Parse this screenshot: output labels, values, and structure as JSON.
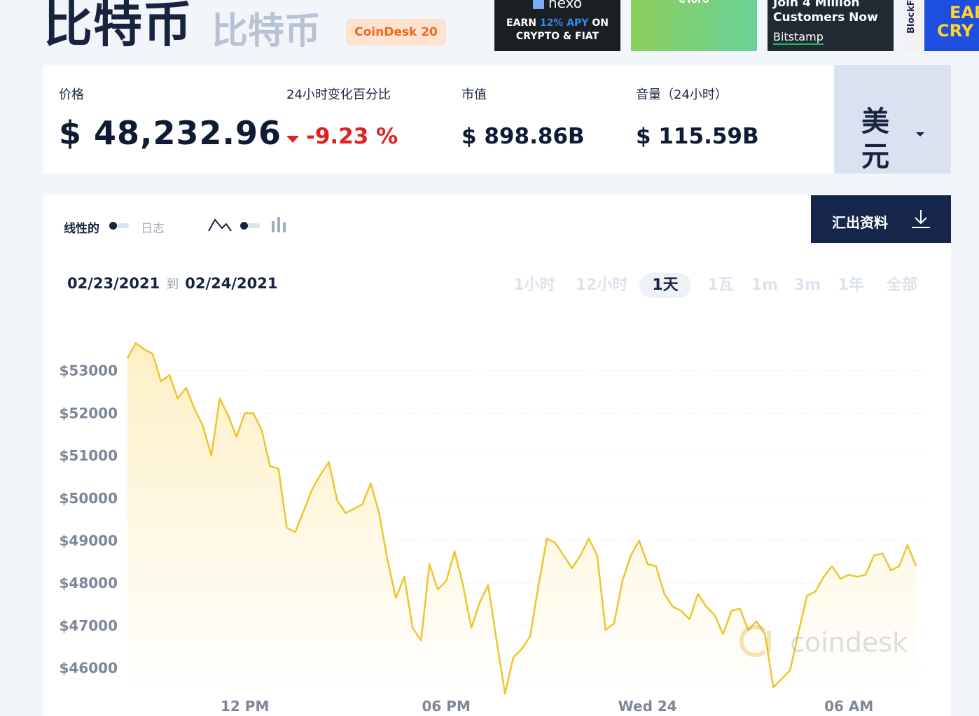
{
  "header": {
    "title": "比特币",
    "subtitle": "比特币",
    "badge": "CoinDesk 20"
  },
  "ads": {
    "nexo": {
      "logo": "nexo",
      "line1_a": "EARN ",
      "line1_hl": "12% APY",
      "line1_b": " ON",
      "line2": "CRYPTO & FIAT"
    },
    "etoro": {
      "logo": "eToro"
    },
    "bitstamp": {
      "line1": "Join 4 Million",
      "line2": "Customers Now",
      "line3": "Bitstamp"
    },
    "blockfi": {
      "side": "BlockFi",
      "line1": "EAR",
      "line2": "CRY"
    }
  },
  "stats": {
    "price": {
      "label": "价格",
      "value": "$ 48,232.96"
    },
    "change": {
      "label": "24小时变化百分比",
      "value": "-9.23 %"
    },
    "market_cap": {
      "label": "市值",
      "value": "$ 898.86B"
    },
    "volume": {
      "label": "音量（24小时）",
      "value": "$ 115.59B"
    },
    "currency": {
      "value": "美元"
    }
  },
  "chart_controls": {
    "linear_label": "线性的",
    "log_label": "日志",
    "export_label": "汇出资料",
    "date_from": "02/23/2021",
    "date_to_sep": "到",
    "date_to": "02/24/2021",
    "ranges": [
      "1小时",
      "12小时",
      "1天",
      "1瓦",
      "1m",
      "3m",
      "1年",
      "全部"
    ],
    "active_range": "1天"
  },
  "colors": {
    "line": "#f0c42c",
    "fill_top": "#fdf0c4",
    "fill_bottom": "#ffffff",
    "down": "#e0211d",
    "navy": "#16264a"
  },
  "chart_data": {
    "type": "area",
    "y_axis_prefix": "$",
    "yticks": [
      53000,
      52000,
      51000,
      50000,
      49000,
      48000,
      47000,
      46000
    ],
    "ylim": [
      45400,
      54000
    ],
    "xlim": [
      0,
      95
    ],
    "xticks": [
      {
        "label": "12 PM",
        "x": 14
      },
      {
        "label": "06 PM",
        "x": 38
      },
      {
        "label": "Wed 24",
        "x": 62
      },
      {
        "label": "06 AM",
        "x": 86
      }
    ],
    "grid": true,
    "watermark": "coindesk",
    "values": [
      53300,
      53650,
      53500,
      53400,
      52750,
      52900,
      52350,
      52600,
      52100,
      51700,
      51000,
      52350,
      51950,
      51450,
      52000,
      52000,
      51600,
      50750,
      50700,
      49300,
      49200,
      49700,
      50200,
      50550,
      50850,
      49950,
      49650,
      49750,
      49850,
      50350,
      49650,
      48550,
      47650,
      48150,
      46950,
      46650,
      48450,
      47850,
      48050,
      48750,
      47950,
      46950,
      47550,
      47950,
      46650,
      45400,
      46250,
      46450,
      46750,
      47950,
      49050,
      48950,
      48650,
      48350,
      48650,
      49050,
      48650,
      46900,
      47050,
      48050,
      48650,
      49000,
      48450,
      48400,
      47750,
      47450,
      47350,
      47150,
      47750,
      47450,
      47250,
      46800,
      47350,
      47400,
      46900,
      47100,
      46800,
      45550,
      45750,
      45950,
      46850,
      47700,
      47800,
      48150,
      48400,
      48100,
      48200,
      48150,
      48200,
      48650,
      48700,
      48300,
      48400,
      48900,
      48400
    ]
  }
}
